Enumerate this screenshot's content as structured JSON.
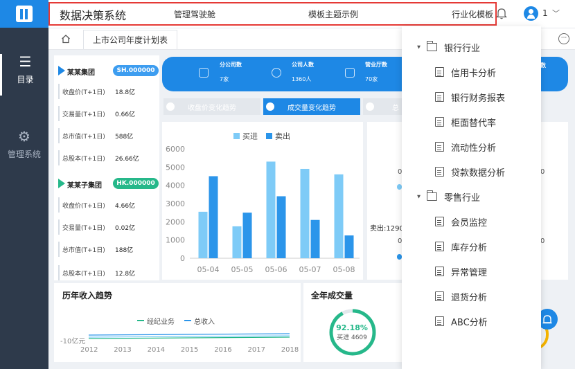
{
  "nav": {
    "items": [
      {
        "label": "目录",
        "icon": "list-icon"
      },
      {
        "label": "管理系统",
        "icon": "gear-icon"
      }
    ]
  },
  "header": {
    "title": "数据决策系统",
    "menu": [
      "管理驾驶舱",
      "模板主题示例",
      "行业化模板"
    ],
    "user": "1"
  },
  "tabs": {
    "current": "上市公司年度计划表"
  },
  "groups": [
    {
      "name": "某某集团",
      "code": "SH.000000",
      "color": "#1e88e5",
      "rows": [
        {
          "k": "收盘价(T+1日)",
          "v": "18.8亿"
        },
        {
          "k": "交易量(T+1日)",
          "v": "0.66亿"
        },
        {
          "k": "总市值(T+1日)",
          "v": "588亿"
        },
        {
          "k": "总股本(T+1日)",
          "v": "26.66亿"
        }
      ]
    },
    {
      "name": "某某子集团",
      "code": "HK.000000",
      "color": "#26b88a",
      "rows": [
        {
          "k": "收盘价(T+1日)",
          "v": "4.66亿"
        },
        {
          "k": "交易量(T+1日)",
          "v": "0.02亿"
        },
        {
          "k": "总市值(T+1日)",
          "v": "188亿"
        },
        {
          "k": "总股本(T+1日)",
          "v": "12.8亿"
        }
      ]
    }
  ],
  "banner": {
    "stats": [
      {
        "label": "分公司数",
        "value": "7家"
      },
      {
        "label": "公司人数",
        "value": "1360人"
      },
      {
        "label": "营业厅数",
        "value": "70家"
      }
    ]
  },
  "chart_tabs": [
    "收盘价变化趋势",
    "成交量变化趋势",
    "总"
  ],
  "right_panel": {
    "sell_label": "卖出:1290",
    "ticks": [
      "0",
      "0"
    ]
  },
  "chart_data": {
    "type": "bar",
    "categories": [
      "05-04",
      "05-05",
      "05-06",
      "05-07",
      "05-08"
    ],
    "series": [
      {
        "name": "买进",
        "values": [
          2550,
          1750,
          5300,
          4900,
          4600
        ],
        "color": "#7ecbf7"
      },
      {
        "name": "卖出",
        "values": [
          4500,
          2500,
          3400,
          2100,
          1250
        ],
        "color": "#2b95ea"
      }
    ],
    "ylim": [
      0,
      6000
    ],
    "yticks": [
      0,
      1000,
      2000,
      3000,
      4000,
      5000,
      6000
    ],
    "grid": false,
    "legend": "top"
  },
  "trend": {
    "title": "历年收入趋势",
    "legend": [
      "经纪业务",
      "总收入"
    ],
    "ylabel": "-10亿元",
    "years": [
      "2012",
      "2013",
      "2014",
      "2015",
      "2016",
      "2017",
      "2018"
    ]
  },
  "volume": {
    "title": "全年成交量",
    "percent": "92.18%",
    "percent_value": 0.9218,
    "sub": "买进 4609"
  },
  "dropdown": {
    "categories": [
      {
        "label": "银行行业",
        "items": [
          "信用卡分析",
          "银行财务报表",
          "柜面替代率",
          "流动性分析",
          "贷款数据分析"
        ]
      },
      {
        "label": "零售行业",
        "items": [
          "会员监控",
          "库存分析",
          "异常管理",
          "退货分析",
          "ABC分析"
        ]
      }
    ]
  }
}
